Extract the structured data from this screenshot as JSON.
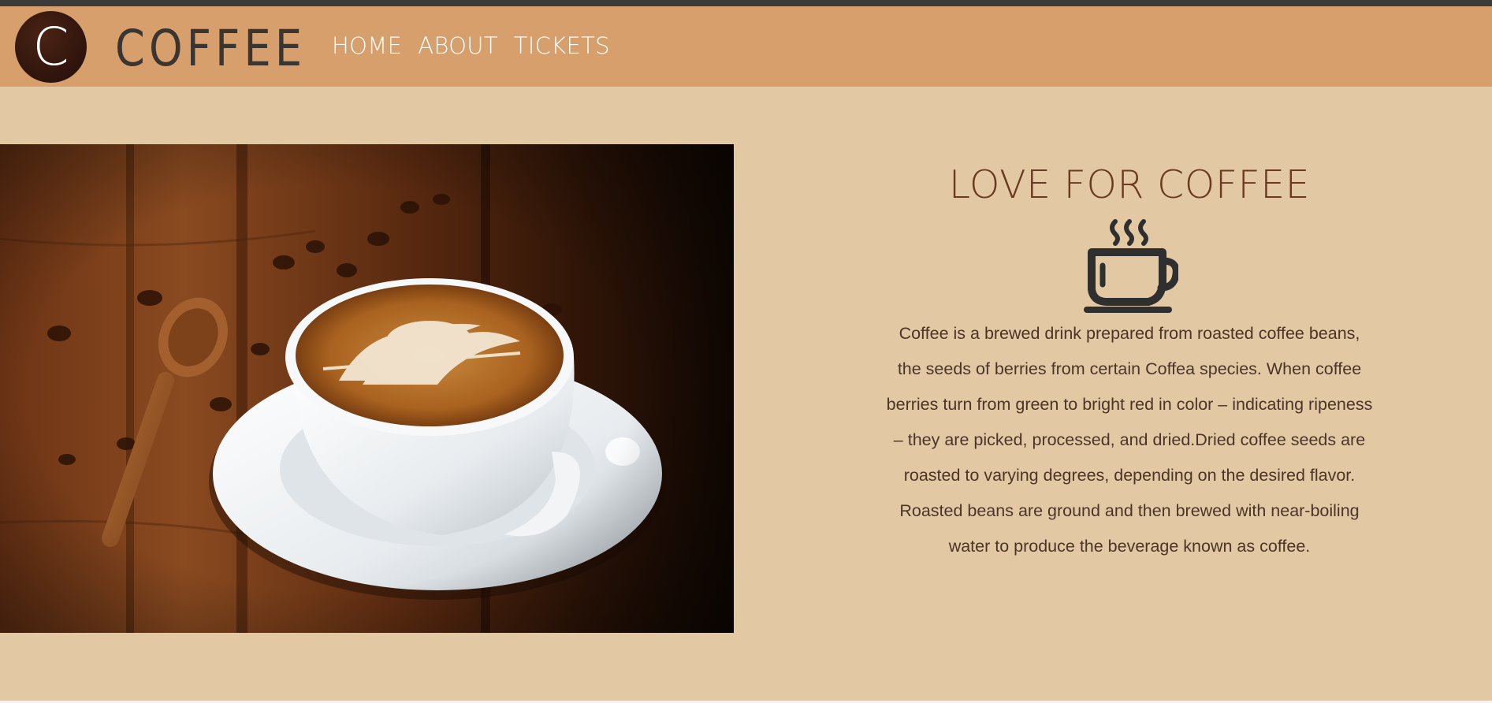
{
  "header": {
    "logo_letter": "C",
    "brand": "COFFEE",
    "nav": [
      {
        "label": "HOME"
      },
      {
        "label": "ABOUT"
      },
      {
        "label": "TICKETS"
      }
    ]
  },
  "hero": {
    "image": "latte-art-coffee-cup-photo"
  },
  "section": {
    "title": "LOVE FOR COFFEE",
    "icon": "coffee-cup-icon",
    "text": "Coffee is a brewed drink prepared from roasted coffee beans, the seeds of berries from certain Coffea species. When coffee berries turn from green to bright red in color – indicating ripeness – they are picked, processed, and dried.Dried coffee seeds are roasted to varying degrees, depending on the desired flavor. Roasted beans are ground and then brewed with near-boiling water to produce the beverage known as coffee."
  },
  "colors": {
    "page_bg": "#e3c8a4",
    "navbar_bg": "#d79f6b",
    "title_color": "#6a3a22",
    "text_color": "#4b3528"
  }
}
